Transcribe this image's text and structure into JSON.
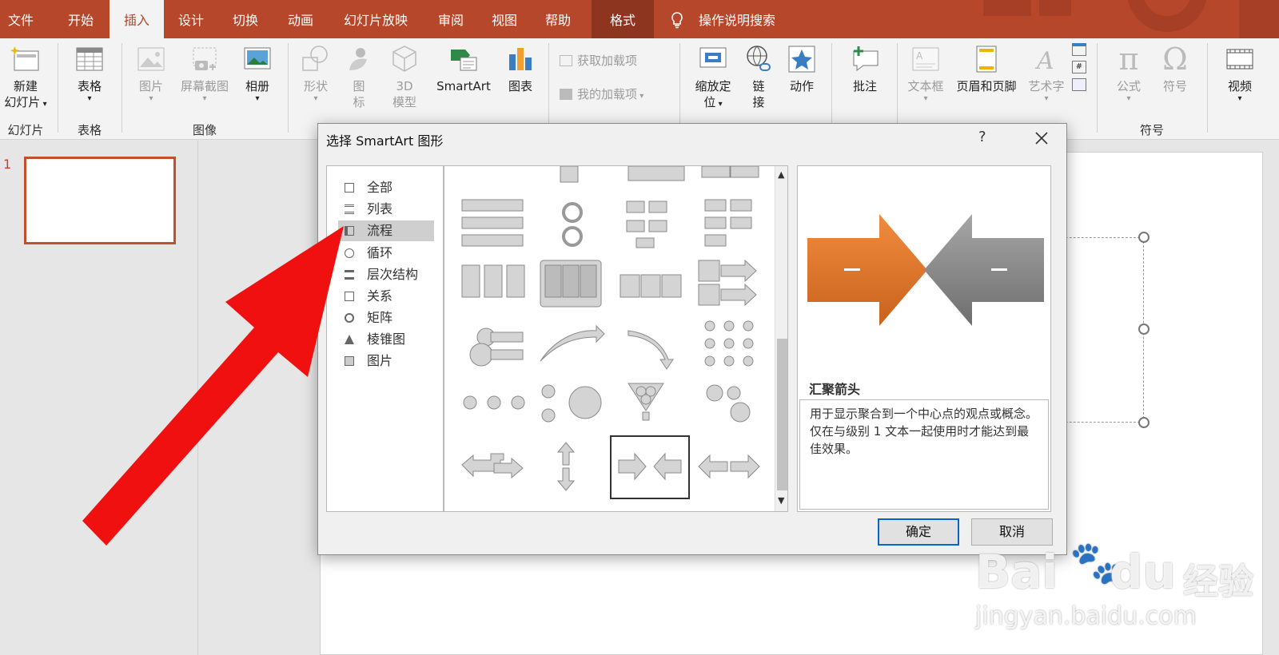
{
  "tabs": [
    "文件",
    "开始",
    "插入",
    "设计",
    "切换",
    "动画",
    "幻灯片放映",
    "审阅",
    "视图",
    "帮助",
    "格式"
  ],
  "active_tab": "插入",
  "tell_me": "操作说明搜索",
  "ribbon": {
    "new_slide": [
      "新建",
      "幻灯片"
    ],
    "table": "表格",
    "picture": "图片",
    "screenshot": "屏幕截图",
    "album": "相册",
    "shapes": "形状",
    "icons": [
      "图",
      "标"
    ],
    "model3d": [
      "3D",
      "模型"
    ],
    "smartart": "SmartArt",
    "chart": "图表",
    "get_addins": "获取加载项",
    "my_addins": "我的加载项",
    "zoom": [
      "缩放定",
      "位"
    ],
    "link": [
      "链",
      "接"
    ],
    "action": "动作",
    "comment": "批注",
    "textbox": "文本框",
    "header_footer": "页眉和页脚",
    "wordart": "艺术字",
    "equation": "公式",
    "symbol": "符号",
    "video": "视频",
    "groups": {
      "slides": "幻灯片",
      "tables": "表格",
      "images": "图像",
      "symbols": "符号"
    }
  },
  "slide_number": "1",
  "dialog": {
    "title": "选择 SmartArt 图形",
    "help": "?",
    "categories": [
      "全部",
      "列表",
      "流程",
      "循环",
      "层次结构",
      "关系",
      "矩阵",
      "棱锥图",
      "图片"
    ],
    "selected_category": "流程",
    "preview_name": "汇聚箭头",
    "preview_desc": "用于显示聚合到一个中心点的观点或概念。仅在与级别 1 文本一起使用时才能达到最佳效果。",
    "ok": "确定",
    "cancel": "取消"
  },
  "watermark": {
    "brand": "Bai",
    "brand2": "du",
    "cn": "经验",
    "url": "jingyan.baidu.com"
  },
  "colors": {
    "accent": "#b7472a",
    "orange": "#e07a2a",
    "gray_arrow": "#8c8c8c",
    "pointer": "#f01010"
  }
}
